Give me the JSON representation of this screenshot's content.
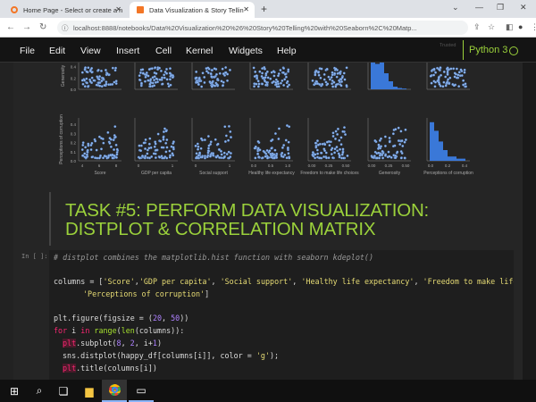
{
  "browser": {
    "tabs": [
      {
        "title": "Home Page - Select or create a n"
      },
      {
        "title": "Data Visualization & Story Tellin"
      }
    ],
    "new_tab": "+",
    "url": "localhost:8888/notebooks/Data%20Visualization%20%26%20Story%20Telling%20with%20Seaborn%2C%20Matp..."
  },
  "menu": {
    "items": [
      "File",
      "Edit",
      "View",
      "Insert",
      "Cell",
      "Kernel",
      "Widgets",
      "Help"
    ],
    "trusted": "Trusted",
    "kernel": "Python 3"
  },
  "pairplot": {
    "row_labels": [
      "Generosity",
      "Perceptions of corruption"
    ],
    "x_labels": [
      "Score",
      "GDP per capita",
      "Social support",
      "Healthy life expectancy",
      "Freedom to make life choices",
      "Generosity",
      "Perceptions of corruption"
    ],
    "row1_yticks": [
      "0.0",
      "0.2",
      "0.4"
    ],
    "row2_yticks": [
      "0.0",
      "0.1",
      "0.2",
      "0.3",
      "0.4"
    ],
    "xticks": [
      [
        "4",
        "6",
        "8"
      ],
      [
        "0",
        "1"
      ],
      [
        "0",
        "1"
      ],
      [
        "0.0",
        "0.5",
        "1.0"
      ],
      [
        "0.00",
        "0.25",
        "0.50"
      ],
      [
        "0.00",
        "0.25",
        "0.50"
      ],
      [
        "0.0",
        "0.2",
        "0.4"
      ]
    ],
    "point_color": "#8fb8f0",
    "hist_color": "#3a78d8"
  },
  "markdown": {
    "heading_line1": "TASK #5: PERFORM DATA VISUALIZATION:",
    "heading_line2": "DISTPLOT & CORRELATION MATRIX"
  },
  "code_cell": {
    "prompt": "In [ ]:",
    "lines": {
      "l1": "# distplot combines the matplotlib.hist function with seaborn kdeplot()",
      "l2a": "columns = [",
      "l2b": "'Score'",
      "l2c": ",",
      "l2d": "'GDP per capita'",
      "l2e": ", ",
      "l2f": "'Social support'",
      "l2g": ", ",
      "l2h": "'Healthy life expectancy'",
      "l2i": ", ",
      "l2j": "'Freedom to make life cho:",
      "l3": "'Perceptions of corruption'",
      "l3b": "]",
      "l4a": "plt.figure(figsize = (",
      "l4b": "20",
      "l4c": ", ",
      "l4d": "50",
      "l4e": "))",
      "l5a": "for",
      "l5b": " i ",
      "l5c": "in",
      "l5d": " ",
      "l5e": "range",
      "l5f": "(",
      "l5g": "len",
      "l5h": "(columns)):",
      "l6a": "plt",
      "l6b": ".subplot(",
      "l6c": "8",
      "l6d": ", ",
      "l6e": "2",
      "l6f": ", i+",
      "l6g": "1",
      "l6h": ")",
      "l7a": "sns.distplot(happy_df[columns[i]], color = ",
      "l7b": "'g'",
      "l7c": ");",
      "l8a": "plt",
      "l8b": ".title(columns[i])"
    }
  }
}
